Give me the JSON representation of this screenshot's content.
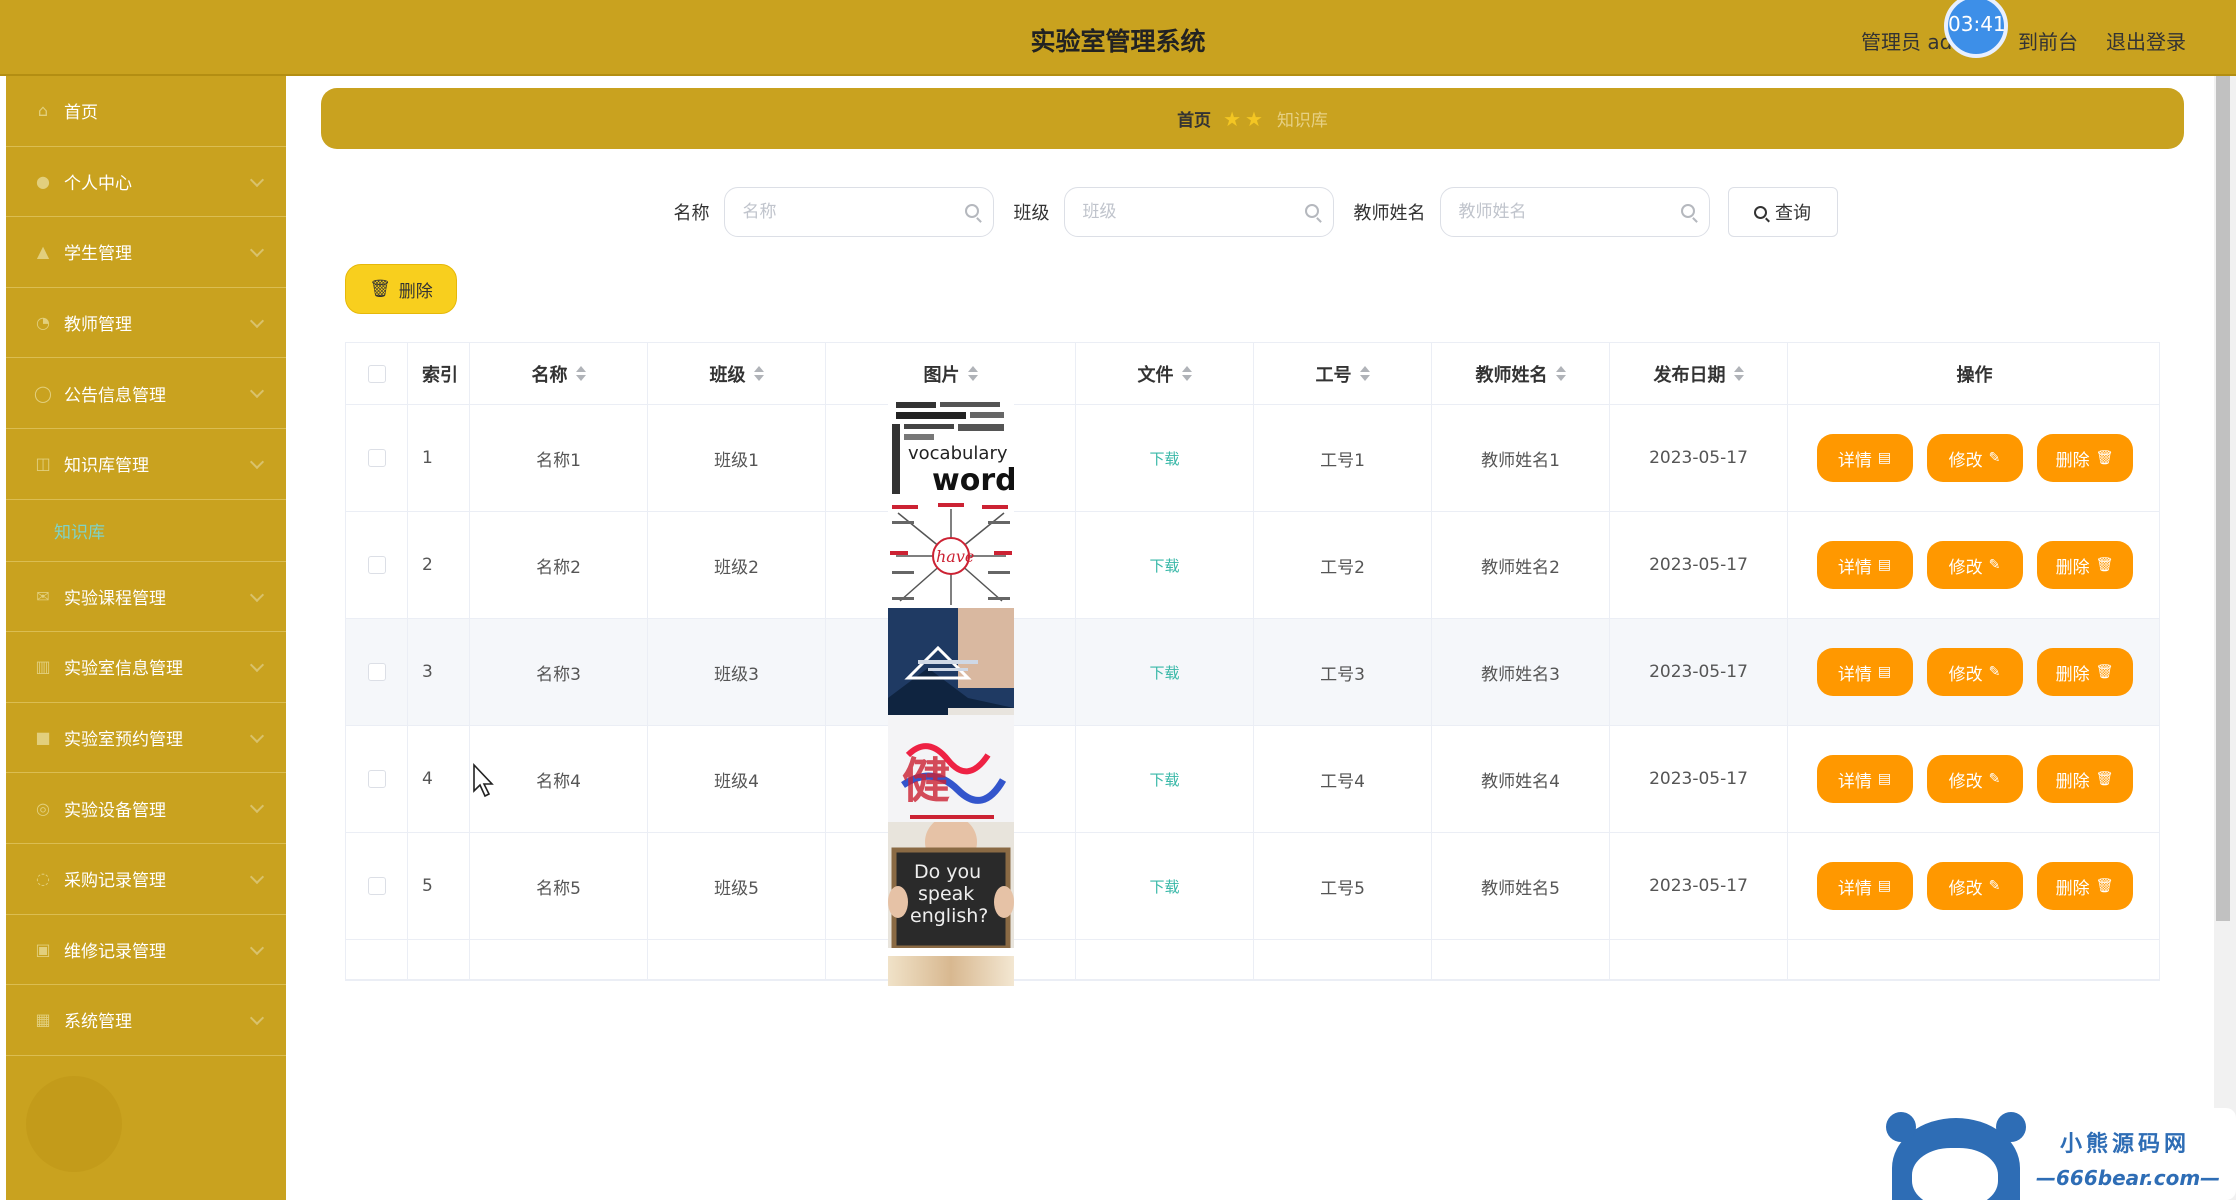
{
  "header": {
    "title": "实验室管理系统",
    "user": "管理员 admin",
    "frontend": "到前台",
    "logout": "退出登录",
    "timer": "03:41"
  },
  "sidebar": {
    "items": [
      {
        "label": "首页",
        "icon": "home-icon"
      },
      {
        "label": "个人中心",
        "icon": "user-icon"
      },
      {
        "label": "学生管理",
        "icon": "student-icon"
      },
      {
        "label": "教师管理",
        "icon": "teacher-icon"
      },
      {
        "label": "公告信息管理",
        "icon": "notice-icon"
      },
      {
        "label": "知识库管理",
        "icon": "knowledge-icon"
      },
      {
        "label": "实验课程管理",
        "icon": "course-icon"
      },
      {
        "label": "实验室信息管理",
        "icon": "lab-icon"
      },
      {
        "label": "实验室预约管理",
        "icon": "booking-icon"
      },
      {
        "label": "实验设备管理",
        "icon": "device-icon"
      },
      {
        "label": "采购记录管理",
        "icon": "purchase-icon"
      },
      {
        "label": "维修记录管理",
        "icon": "repair-icon"
      },
      {
        "label": "系统管理",
        "icon": "system-icon"
      }
    ],
    "sub_item": "知识库"
  },
  "breadcrumb": {
    "home": "首页",
    "current": "知识库"
  },
  "search": {
    "name_label": "名称",
    "name_placeholder": "名称",
    "class_label": "班级",
    "class_placeholder": "班级",
    "teacher_label": "教师姓名",
    "teacher_placeholder": "教师姓名",
    "query_label": "查询"
  },
  "toolbar": {
    "delete_label": "删除"
  },
  "table": {
    "headers": {
      "index": "索引",
      "name": "名称",
      "class": "班级",
      "image": "图片",
      "file": "文件",
      "work_no": "工号",
      "teacher": "教师姓名",
      "date": "发布日期",
      "op": "操作"
    },
    "rows": [
      {
        "index": "1",
        "name": "名称1",
        "class": "班级1",
        "file": "下载",
        "work_no": "工号1",
        "teacher": "教师姓名1",
        "date": "2023-05-17"
      },
      {
        "index": "2",
        "name": "名称2",
        "class": "班级2",
        "file": "下载",
        "work_no": "工号2",
        "teacher": "教师姓名2",
        "date": "2023-05-17"
      },
      {
        "index": "3",
        "name": "名称3",
        "class": "班级3",
        "file": "下载",
        "work_no": "工号3",
        "teacher": "教师姓名3",
        "date": "2023-05-17"
      },
      {
        "index": "4",
        "name": "名称4",
        "class": "班级4",
        "file": "下载",
        "work_no": "工号4",
        "teacher": "教师姓名4",
        "date": "2023-05-17"
      },
      {
        "index": "5",
        "name": "名称5",
        "class": "班级5",
        "file": "下载",
        "work_no": "工号5",
        "teacher": "教师姓名5",
        "date": "2023-05-17"
      }
    ],
    "buttons": {
      "detail": "详情",
      "edit": "修改",
      "delete": "删除"
    }
  },
  "thumbs": {
    "t1_text": "words",
    "t1_text2": "vocabulary",
    "t2_text": "have",
    "t4_text": "健",
    "t5_text1": "Do you",
    "t5_text2": "speak",
    "t5_text3": "english?"
  },
  "watermark": {
    "line1": "小熊源码网",
    "line2": "—666bear.com—"
  },
  "colors": {
    "primary": "#c9a21f",
    "action": "#ff9800",
    "delete_btn": "#f8cf1e",
    "link": "#39b8a8"
  }
}
